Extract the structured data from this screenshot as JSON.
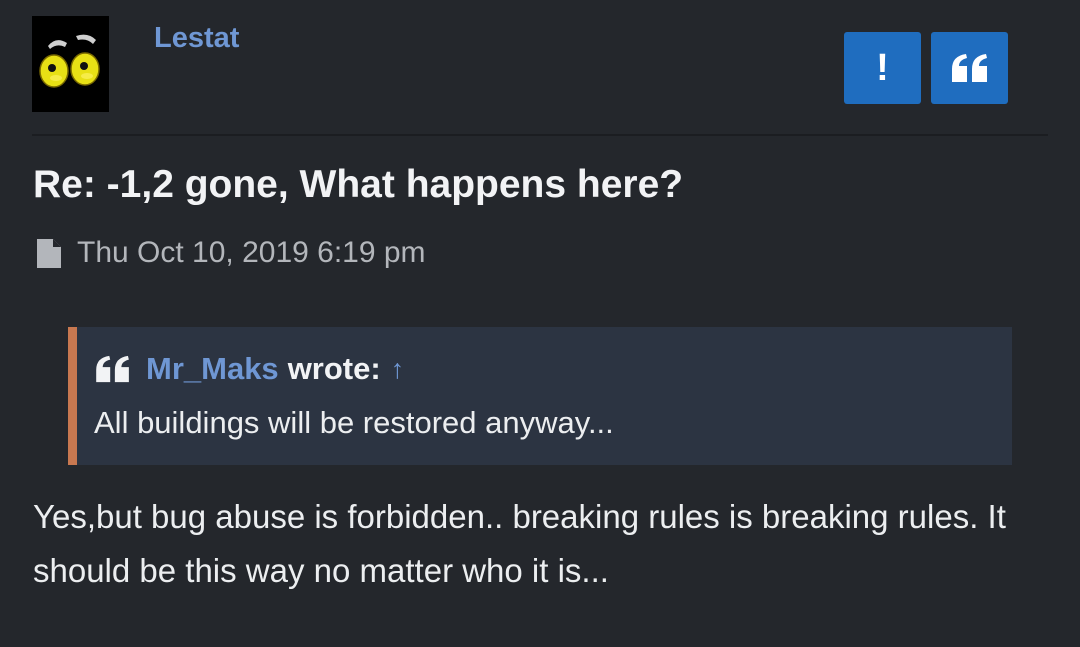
{
  "post": {
    "author": "Lestat",
    "title": "Re: -1,2 gone, What happens here?",
    "datetime": "Thu Oct 10, 2019 6:19 pm",
    "quote": {
      "author": "Mr_Maks",
      "wrote": "wrote:",
      "arrow": "↑",
      "text": "All buildings will be restored anyway..."
    },
    "body": "Yes,but bug abuse is forbidden.. breaking rules is breaking rules. It should be this way no matter who it is..."
  },
  "actions": {
    "report_label": "!"
  },
  "icons": {
    "avatar": "cartoon-eyes-avatar",
    "report": "exclamation-icon",
    "quote": "quote-icon",
    "date": "file-icon"
  },
  "colors": {
    "background": "#24272c",
    "link": "#6f97d4",
    "button": "#1f6dbf",
    "quote_background": "#2c3442",
    "quote_border": "#c87850"
  }
}
